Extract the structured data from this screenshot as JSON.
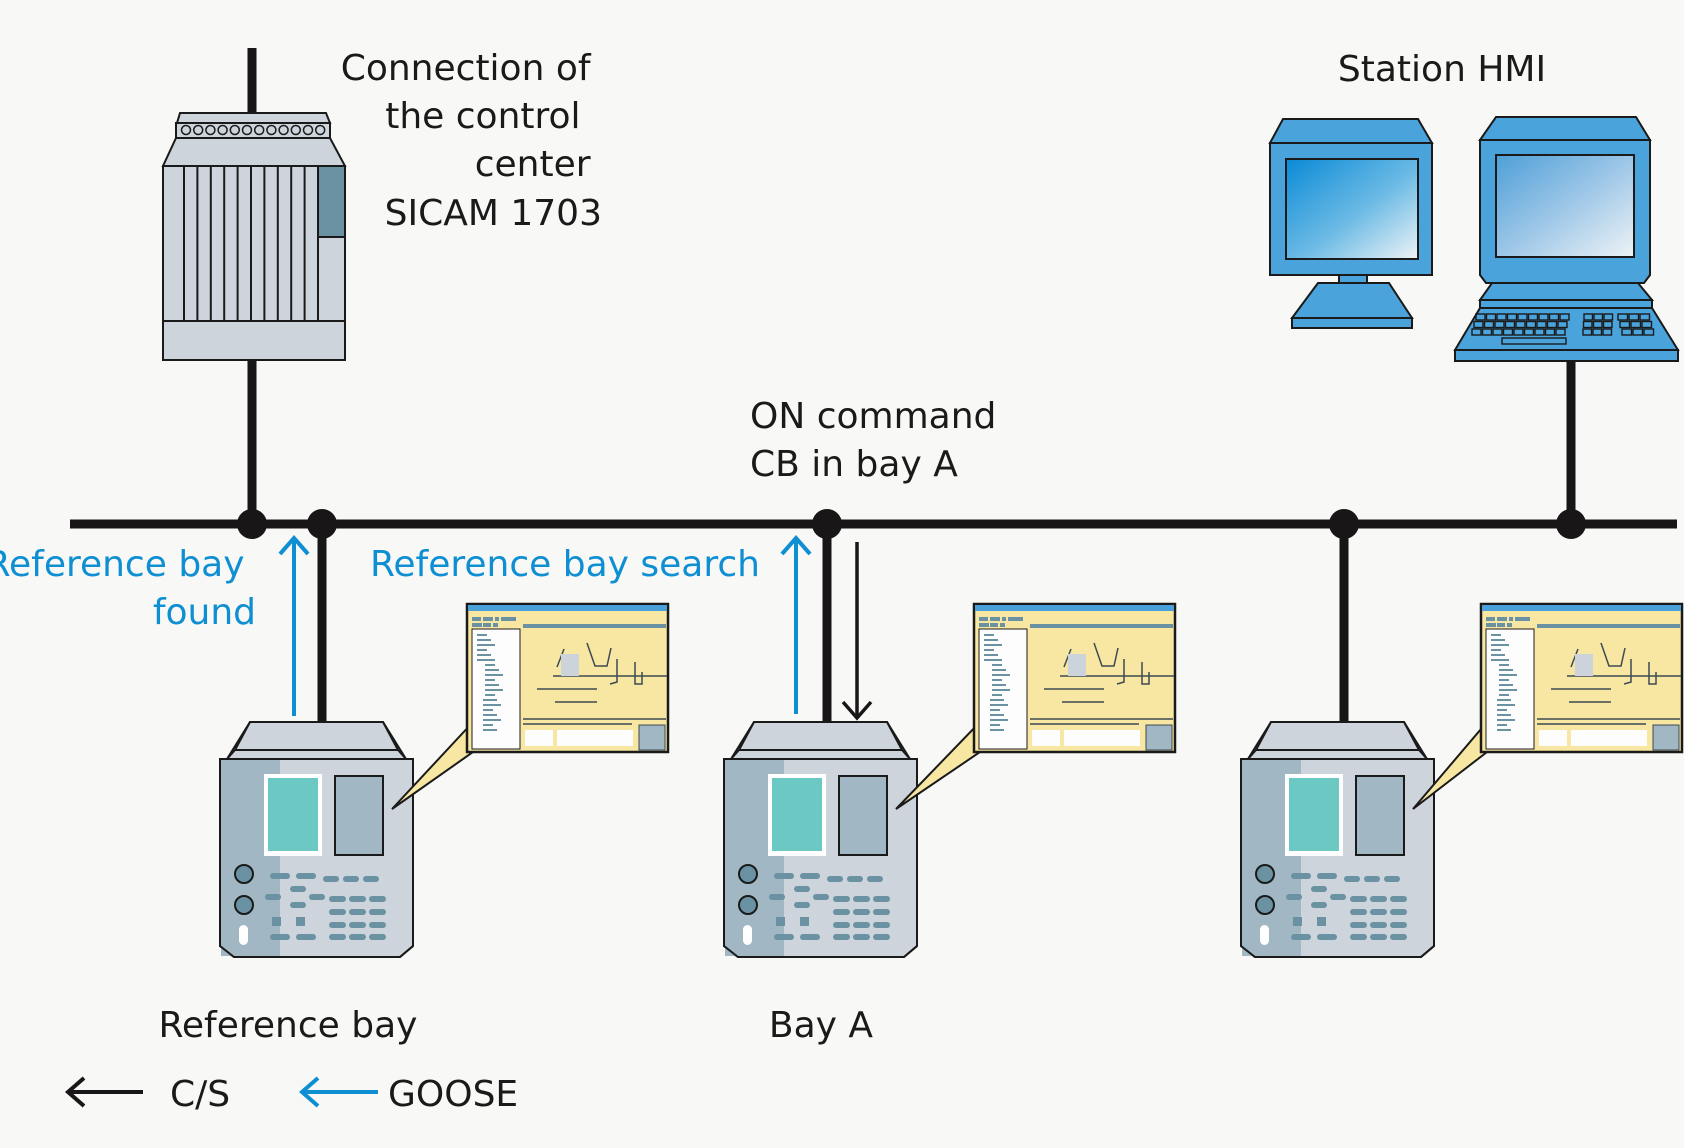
{
  "colors": {
    "background": "#f8f8f6",
    "bus": "#181616",
    "goose_arrow": "#0e8fd3",
    "hmi_blue": "#4aa3da",
    "device_body": "#cdd4db",
    "device_side": "#a1b7c3",
    "device_display": "#6cc8c2",
    "device_keys": "#6a92a3",
    "popup_body": "#f8e7a3",
    "popup_titlebar": "#4aa0d8"
  },
  "labels": {
    "control_center": [
      "Connection of",
      "the control",
      "center",
      "SICAM 1703"
    ],
    "station_hmi": "Station HMI",
    "on_command": [
      "ON command",
      "CB in bay A"
    ],
    "reference_bay_found": [
      "Reference bay",
      "found"
    ],
    "reference_bay_search": "Reference bay search",
    "reference_bay": "Reference bay",
    "bay_a": "Bay A"
  },
  "legend": {
    "items": [
      {
        "label": "C/S",
        "arrow": "left-arrow-black"
      },
      {
        "label": "GOOSE",
        "arrow": "left-arrow-blue"
      }
    ]
  },
  "nodes": {
    "sicam": {
      "icon": "sicam-rack-icon",
      "name": "SICAM 1703"
    },
    "hmi": [
      {
        "icon": "monitor-icon"
      },
      {
        "icon": "workstation-icon"
      }
    ],
    "bays": [
      {
        "name": "Reference bay",
        "icon": "bay-controller-icon"
      },
      {
        "name": "Bay A",
        "icon": "bay-controller-icon"
      },
      {
        "name": "",
        "icon": "bay-controller-icon"
      }
    ]
  }
}
